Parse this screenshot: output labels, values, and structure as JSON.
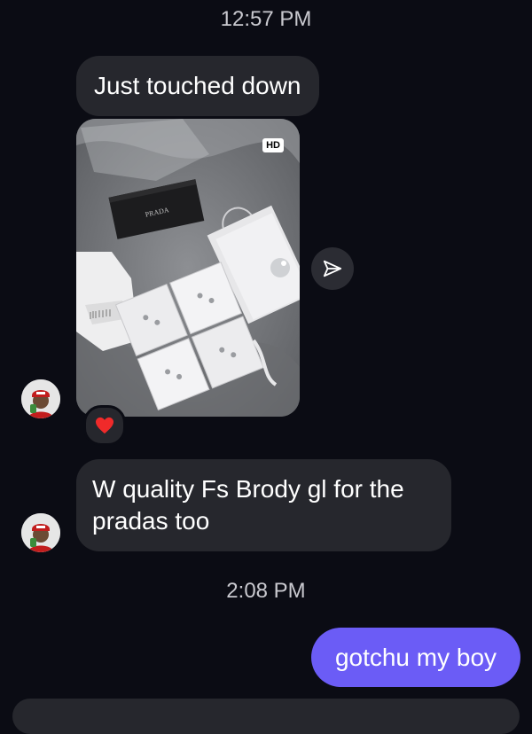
{
  "messages": {
    "timestamp_1": "12:57 PM",
    "msg_1": "Just touched down",
    "photo_badge": "HD",
    "photo_brand_text": "PRADA",
    "reaction_emoji": "❤️",
    "msg_2_line1": "W quality Fs Brody gl for the",
    "msg_2_line2": "pradas too",
    "timestamp_2": "2:08 PM",
    "msg_3": "gotchu my boy"
  },
  "colors": {
    "background": "#0b0c14",
    "incoming_bubble": "#26272d",
    "outgoing_bubble": "#6b5cf6"
  }
}
